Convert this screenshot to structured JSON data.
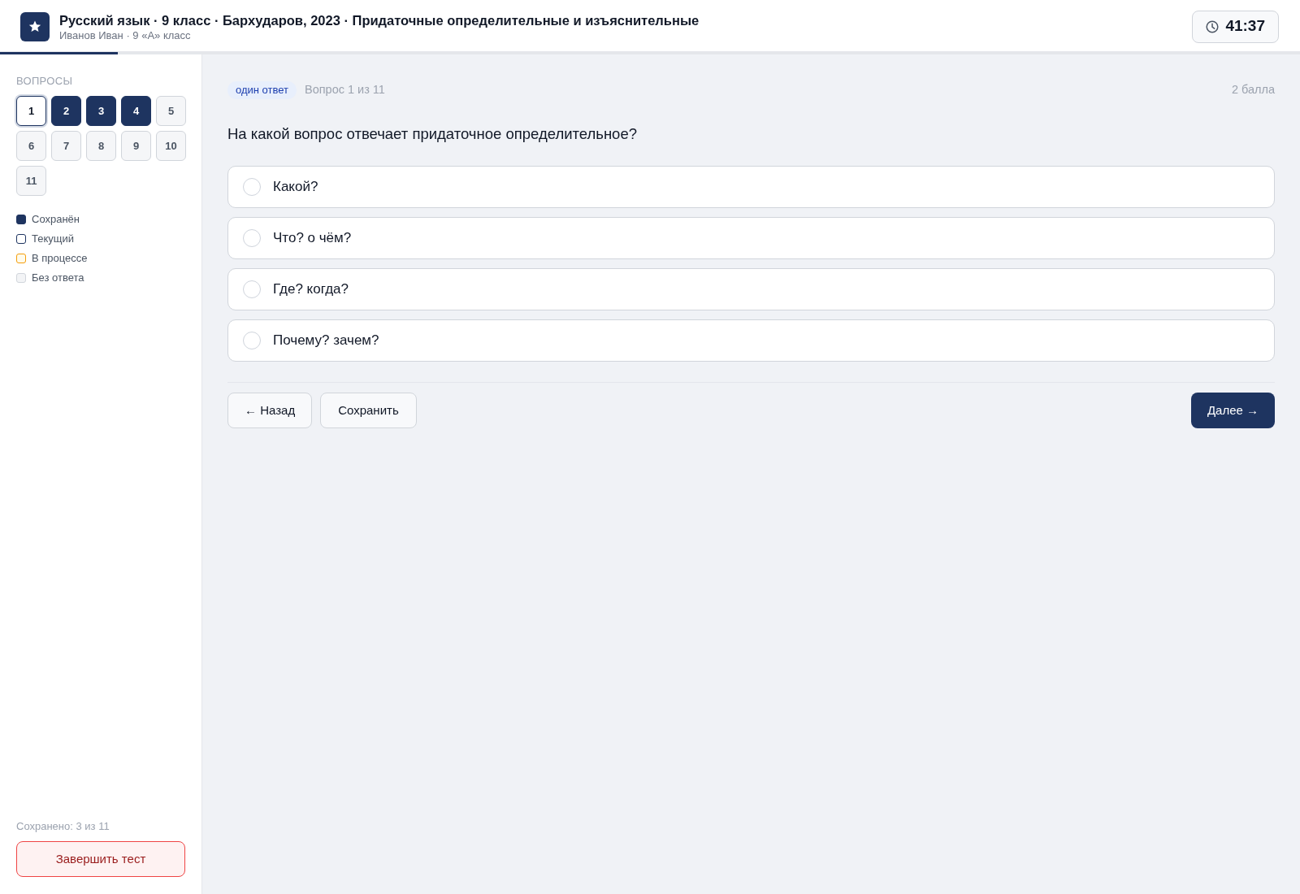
{
  "header": {
    "title": "Русский язык · 9 класс · Бархударов, 2023 · Придаточные определительные и изъяснительные",
    "subtitle": "Иванов Иван · 9 «А» класс",
    "timer": "41:37"
  },
  "progress": {
    "level": 0.0909
  },
  "sidebar": {
    "heading": "ВОПРОСЫ",
    "questions": [
      {
        "label": "1",
        "saved": false,
        "selected": true
      },
      {
        "label": "2",
        "saved": true,
        "selected": false
      },
      {
        "label": "3",
        "saved": true,
        "selected": false
      },
      {
        "label": "4",
        "saved": true,
        "selected": false
      },
      {
        "label": "5",
        "saved": false,
        "selected": false
      },
      {
        "label": "6",
        "saved": false,
        "selected": false
      },
      {
        "label": "7",
        "saved": false,
        "selected": false
      },
      {
        "label": "8",
        "saved": false,
        "selected": false
      },
      {
        "label": "9",
        "saved": false,
        "selected": false
      },
      {
        "label": "10",
        "saved": false,
        "selected": false
      },
      {
        "label": "11",
        "saved": false,
        "selected": false
      }
    ],
    "legend": [
      {
        "kind": "saved",
        "label": "Сохранён"
      },
      {
        "kind": "current",
        "label": "Текущий"
      },
      {
        "kind": "in_progress",
        "label": "В процессе"
      },
      {
        "kind": "unanswered",
        "label": "Без ответа"
      }
    ],
    "saved_count": "Сохранено: 3 из 11",
    "finish_button": "Завершить тест"
  },
  "question": {
    "badge": "один ответ",
    "counter": "Вопрос 1 из 11",
    "points": "2 балла",
    "text": "На какой вопрос отвечает придаточное определительное?",
    "options": [
      {
        "label": "Какой?",
        "selected": false
      },
      {
        "label": "Что? о чём?",
        "selected": false
      },
      {
        "label": "Где? когда?",
        "selected": false
      },
      {
        "label": "Почему? зачем?",
        "selected": false
      }
    ]
  },
  "buttons": {
    "back": "← Назад",
    "save": "Сохранить",
    "next": "Далее →"
  }
}
